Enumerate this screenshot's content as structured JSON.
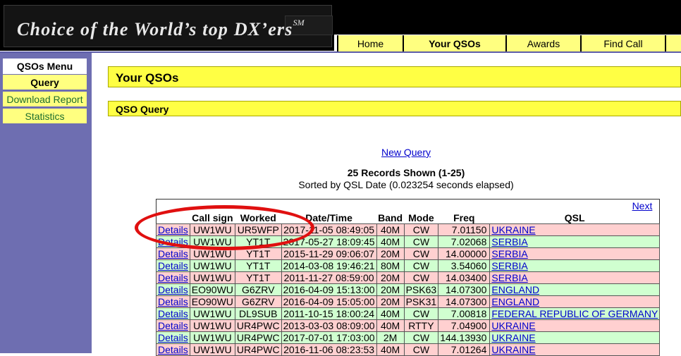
{
  "banner": {
    "title": "Choice of the World’s top DX’ers",
    "mark": "SM"
  },
  "topnav": [
    {
      "label": "Home",
      "active": false,
      "width": 93
    },
    {
      "label": "Your QSOs",
      "active": true,
      "width": 146
    },
    {
      "label": "Awards",
      "active": false,
      "width": 106
    },
    {
      "label": "Find Call",
      "active": false,
      "width": 120
    },
    {
      "label": "",
      "active": false,
      "width": 27
    }
  ],
  "sidebar": {
    "heading": "QSOs Menu",
    "items": [
      {
        "label": "Query",
        "active": true
      },
      {
        "label": "Download Report",
        "active": false
      },
      {
        "label": "Statistics",
        "active": false
      }
    ]
  },
  "page": {
    "title": "Your QSOs",
    "subtitle": "QSO Query",
    "new_query": "New Query"
  },
  "results": {
    "shown": "25 Records Shown (1-25)",
    "sorted": "Sorted by QSL Date (0.023254 seconds elapsed)",
    "next": "Next"
  },
  "table": {
    "columns": [
      "",
      "Call sign",
      "Worked",
      "Date/Time",
      "Band",
      "Mode",
      "Freq",
      "QSL"
    ],
    "rows": [
      {
        "details": "Details",
        "call": "UW1WU",
        "worked": "UR5WFP",
        "datetime": "2017-11-05 08:49:05",
        "band": "40M",
        "mode": "CW",
        "freq": "7.01150",
        "qsl": "UKRAINE",
        "color": "pink"
      },
      {
        "details": "Details",
        "call": "UW1WU",
        "worked": "YT1T",
        "datetime": "2017-05-27 18:09:45",
        "band": "40M",
        "mode": "CW",
        "freq": "7.02068",
        "qsl": "SERBIA",
        "color": "green"
      },
      {
        "details": "Details",
        "call": "UW1WU",
        "worked": "YT1T",
        "datetime": "2015-11-29 09:06:07",
        "band": "20M",
        "mode": "CW",
        "freq": "14.00000",
        "qsl": "SERBIA",
        "color": "pink"
      },
      {
        "details": "Details",
        "call": "UW1WU",
        "worked": "YT1T",
        "datetime": "2014-03-08 19:46:21",
        "band": "80M",
        "mode": "CW",
        "freq": "3.54060",
        "qsl": "SERBIA",
        "color": "green"
      },
      {
        "details": "Details",
        "call": "UW1WU",
        "worked": "YT1T",
        "datetime": "2011-11-27 08:59:00",
        "band": "20M",
        "mode": "CW",
        "freq": "14.03400",
        "qsl": "SERBIA",
        "color": "pink"
      },
      {
        "details": "Details",
        "call": "EO90WU",
        "worked": "G6ZRV",
        "datetime": "2016-04-09 15:13:00",
        "band": "20M",
        "mode": "PSK63",
        "freq": "14.07300",
        "qsl": "ENGLAND",
        "color": "green"
      },
      {
        "details": "Details",
        "call": "EO90WU",
        "worked": "G6ZRV",
        "datetime": "2016-04-09 15:05:00",
        "band": "20M",
        "mode": "PSK31",
        "freq": "14.07300",
        "qsl": "ENGLAND",
        "color": "pink"
      },
      {
        "details": "Details",
        "call": "UW1WU",
        "worked": "DL9SUB",
        "datetime": "2011-10-15 18:00:24",
        "band": "40M",
        "mode": "CW",
        "freq": "7.00818",
        "qsl": "FEDERAL REPUBLIC OF GERMANY",
        "color": "green"
      },
      {
        "details": "Details",
        "call": "UW1WU",
        "worked": "UR4PWC",
        "datetime": "2013-03-03 08:09:00",
        "band": "40M",
        "mode": "RTTY",
        "freq": "7.04900",
        "qsl": "UKRAINE",
        "color": "pink"
      },
      {
        "details": "Details",
        "call": "UW1WU",
        "worked": "UR4PWC",
        "datetime": "2017-07-01 17:03:00",
        "band": "2M",
        "mode": "CW",
        "freq": "144.13930",
        "qsl": "UKRAINE",
        "color": "green"
      },
      {
        "details": "Details",
        "call": "UW1WU",
        "worked": "UR4PWC",
        "datetime": "2016-11-06 08:23:53",
        "band": "40M",
        "mode": "CW",
        "freq": "7.01264",
        "qsl": "UKRAINE",
        "color": "pink"
      }
    ]
  }
}
